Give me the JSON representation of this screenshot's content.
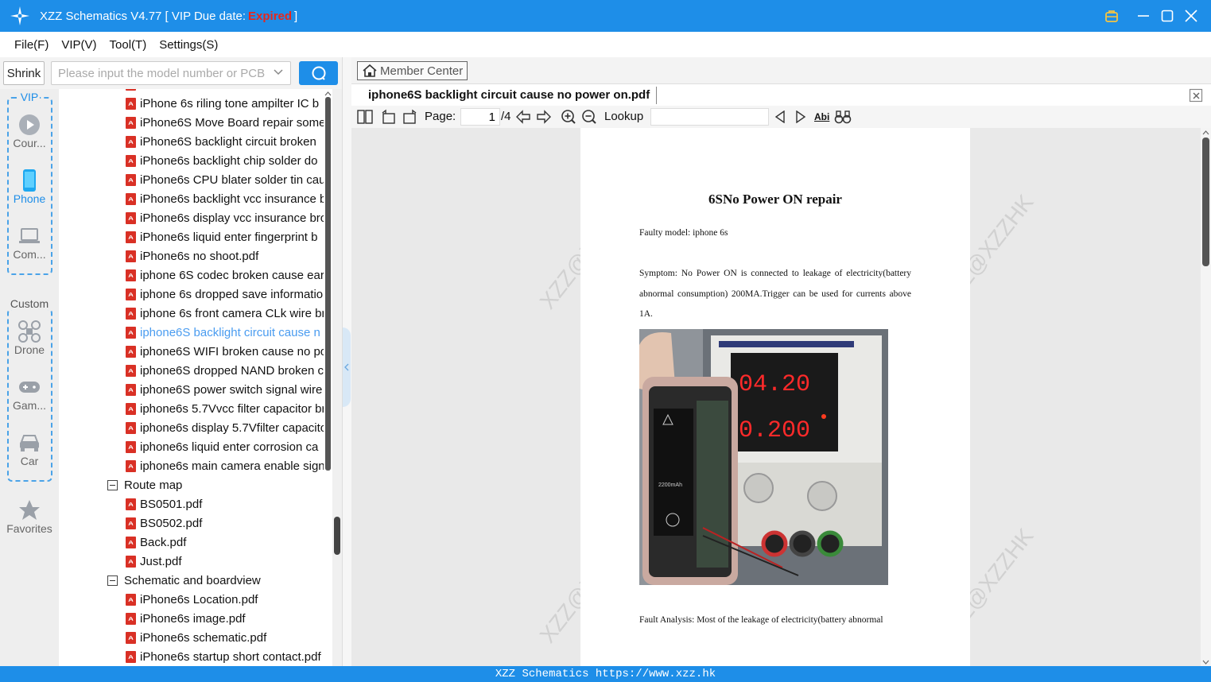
{
  "window": {
    "title_prefix": "XZZ Schematics V4.77 [ VIP Due date:",
    "expired": "Expired",
    "title_suffix": "]"
  },
  "menu": [
    "File(F)",
    "VIP(V)",
    "Tool(T)",
    "Settings(S)"
  ],
  "sidebar": {
    "shrink_label": "Shrink",
    "vip_label": "VIP",
    "custom_label": "Custom",
    "items": [
      {
        "label": "Cour...",
        "icon": "play-icon"
      },
      {
        "label": "Phone",
        "icon": "phone-icon"
      },
      {
        "label": "Com...",
        "icon": "laptop-icon"
      },
      {
        "label": "Drone",
        "icon": "drone-icon"
      },
      {
        "label": "Gam...",
        "icon": "gamepad-icon"
      },
      {
        "label": "Car",
        "icon": "car-icon"
      },
      {
        "label": "Favorites",
        "icon": "star-icon"
      }
    ]
  },
  "search": {
    "placeholder": "Please input the model number or PCB"
  },
  "tree": {
    "files_top": [
      "iPhone 6s riling tone ampilter IC b",
      "iPhone6S Move Board repair some",
      "iPhone6S backlight circuit broken",
      "iPhone6s  backlight chip solder do",
      "iPhone6s CPU blater solder tin cau",
      "iPhone6s backlight vcc insurance b",
      "iPhone6s display vcc insurance bro",
      "iPhone6s liquid enter fingerprint b",
      "iPhone6s no shoot.pdf",
      "iphone 6S codec broken cause ear",
      "iphone 6s dropped save informatio",
      "iphone 6s front camera CLk wire br",
      "iphone6S  backlight circuit cause n",
      "iphone6S WIFI broken cause no po",
      "iphone6S dropped NAND broken c",
      "iphone6S power switch signal wire",
      "iphone6s 5.7Vvcc filter capacitor br",
      "iphone6s display 5.7Vfilter capacito",
      "iphone6s liquid enter corrosion ca",
      "iphone6s main camera enable sign"
    ],
    "selected_index": 12,
    "route_map": {
      "label": "Route map",
      "files": [
        "BS0501.pdf",
        "BS0502.pdf",
        "Back.pdf",
        "Just.pdf"
      ]
    },
    "schematic": {
      "label": "Schematic and boardview",
      "files": [
        "iPhone6s Location.pdf",
        "iPhone6s image.pdf",
        "iPhone6s schematic.pdf",
        "iPhone6s startup short contact.pdf"
      ]
    }
  },
  "viewer_header": {
    "member_center": "Member Center",
    "doc_name": "iphone6S  backlight circuit cause no power on.pdf"
  },
  "toolbar": {
    "page_label": "Page:",
    "page_value": "1",
    "page_total": "/4",
    "lookup_label": "Lookup",
    "abi_label": "Abi"
  },
  "document": {
    "title": "6SNo Power ON repair",
    "faulty_model": "Faulty model: iphone 6s",
    "symptom": "Symptom: No Power ON is connected to leakage of electricity(battery abnormal consumption) 200MA.Trigger can be used for currents above 1A.",
    "fault_analysis": "Fault Analysis: Most of the leakage of electricity(battery abnormal",
    "watermark": "XZZ@XZZHK",
    "psu_voltage": "04.20",
    "psu_current": "0.200",
    "battery_label": "2200mAh"
  },
  "statusbar": {
    "text": "XZZ Schematics https://www.xzz.hk"
  }
}
